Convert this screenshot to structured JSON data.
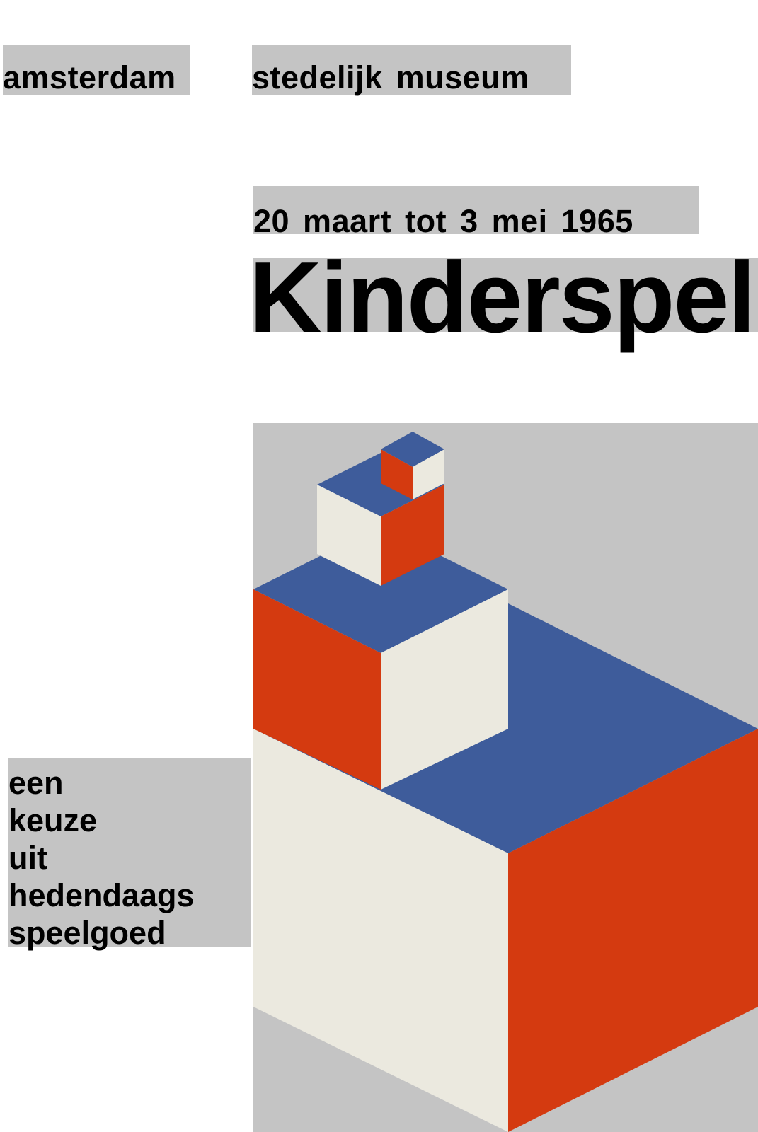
{
  "poster": {
    "city": "amsterdam",
    "venue": "stedelijk museum",
    "dates": "20 maart tot 3 mei 1965",
    "title": "Kinderspel",
    "subtitle_lines": [
      "een",
      "keuze",
      "uit",
      "hedendaags",
      "speelgoed"
    ]
  },
  "colors": {
    "label_grey": "#c4c4c4",
    "block_blue": "#3e5c9b",
    "block_red": "#d43a10",
    "block_cream": "#ebe9df",
    "text": "#000000",
    "background": "#ffffff"
  },
  "icons": {
    "illustration": "isometric-stacked-blocks-illustration"
  }
}
